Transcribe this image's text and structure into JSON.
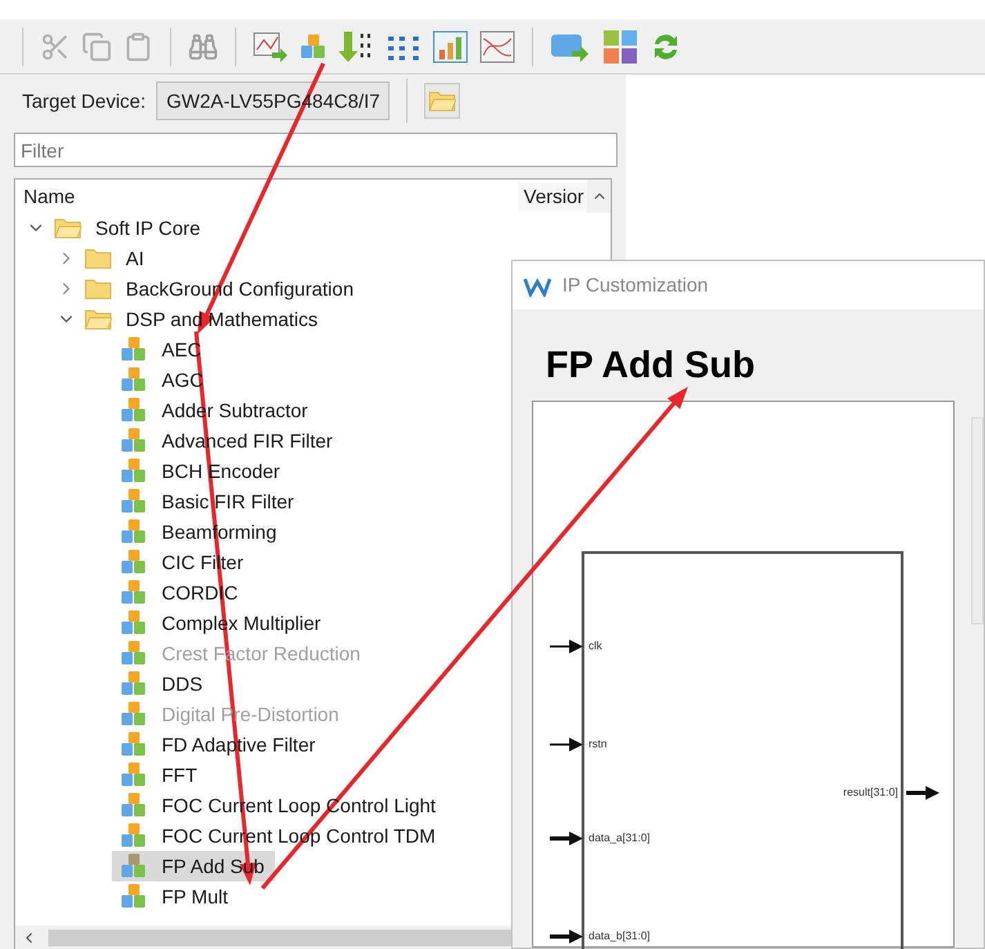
{
  "target_device": {
    "label": "Target Device:",
    "value": "GW2A-LV55PG484C8/I7"
  },
  "filter": {
    "placeholder": "Filter"
  },
  "tree": {
    "columns": [
      "Name",
      "Versior"
    ],
    "items": [
      {
        "label": "Soft IP Core",
        "kind": "folder",
        "expanded": true,
        "selected": false,
        "children": [
          {
            "label": "AI",
            "kind": "folder",
            "expanded": false,
            "selected": false
          },
          {
            "label": "BackGround Configuration",
            "kind": "folder",
            "expanded": false,
            "selected": false
          },
          {
            "label": "DSP and Mathematics",
            "kind": "folder",
            "expanded": true,
            "selected": false,
            "children": [
              {
                "label": "AEC",
                "kind": "ip",
                "disabled": false,
                "selected": false
              },
              {
                "label": "AGC",
                "kind": "ip",
                "disabled": false,
                "selected": false
              },
              {
                "label": "Adder Subtractor",
                "kind": "ip",
                "disabled": false,
                "selected": false
              },
              {
                "label": "Advanced FIR Filter",
                "kind": "ip",
                "disabled": false,
                "selected": false
              },
              {
                "label": "BCH Encoder",
                "kind": "ip",
                "disabled": false,
                "selected": false
              },
              {
                "label": "Basic FIR Filter",
                "kind": "ip",
                "disabled": false,
                "selected": false
              },
              {
                "label": "Beamforming",
                "kind": "ip",
                "disabled": false,
                "selected": false
              },
              {
                "label": "CIC Filter",
                "kind": "ip",
                "disabled": false,
                "selected": false
              },
              {
                "label": "CORDIC",
                "kind": "ip",
                "disabled": false,
                "selected": false
              },
              {
                "label": "Complex Multiplier",
                "kind": "ip",
                "disabled": false,
                "selected": false
              },
              {
                "label": "Crest Factor Reduction",
                "kind": "ip",
                "disabled": true,
                "selected": false
              },
              {
                "label": "DDS",
                "kind": "ip",
                "disabled": false,
                "selected": false
              },
              {
                "label": "Digital Pre-Distortion",
                "kind": "ip",
                "disabled": true,
                "selected": false
              },
              {
                "label": "FD Adaptive Filter",
                "kind": "ip",
                "disabled": false,
                "selected": false
              },
              {
                "label": "FFT",
                "kind": "ip",
                "disabled": false,
                "selected": false
              },
              {
                "label": "FOC Current Loop Control Light",
                "kind": "ip",
                "disabled": false,
                "selected": false
              },
              {
                "label": "FOC Current Loop Control TDM",
                "kind": "ip",
                "disabled": false,
                "selected": false
              },
              {
                "label": "FP Add Sub",
                "kind": "ip",
                "disabled": false,
                "selected": true
              },
              {
                "label": "FP Mult",
                "kind": "ip",
                "disabled": false,
                "selected": false
              }
            ]
          }
        ]
      }
    ]
  },
  "dialog": {
    "title": "IP Customization",
    "heading": "FP Add Sub",
    "ports": [
      {
        "name": "clk",
        "kind": "input"
      },
      {
        "name": "rstn",
        "kind": "input"
      },
      {
        "name": "data_a[31:0]",
        "kind": "input"
      },
      {
        "name": "data_b[31:0]",
        "kind": "input"
      },
      {
        "name": "result[31:0]",
        "kind": "output"
      }
    ]
  }
}
